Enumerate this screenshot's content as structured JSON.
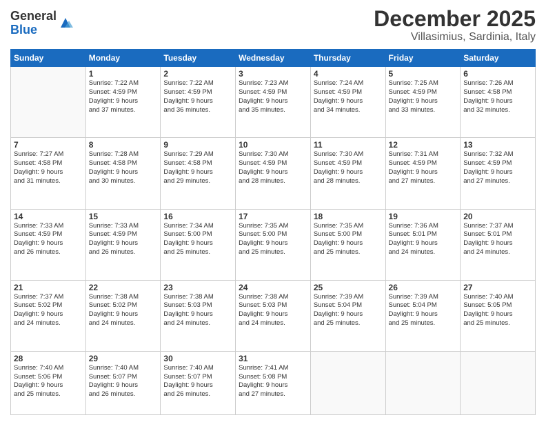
{
  "logo": {
    "general": "General",
    "blue": "Blue"
  },
  "header": {
    "month": "December 2025",
    "location": "Villasimius, Sardinia, Italy"
  },
  "weekdays": [
    "Sunday",
    "Monday",
    "Tuesday",
    "Wednesday",
    "Thursday",
    "Friday",
    "Saturday"
  ],
  "weeks": [
    [
      {
        "day": "",
        "info": ""
      },
      {
        "day": "1",
        "info": "Sunrise: 7:22 AM\nSunset: 4:59 PM\nDaylight: 9 hours\nand 37 minutes."
      },
      {
        "day": "2",
        "info": "Sunrise: 7:22 AM\nSunset: 4:59 PM\nDaylight: 9 hours\nand 36 minutes."
      },
      {
        "day": "3",
        "info": "Sunrise: 7:23 AM\nSunset: 4:59 PM\nDaylight: 9 hours\nand 35 minutes."
      },
      {
        "day": "4",
        "info": "Sunrise: 7:24 AM\nSunset: 4:59 PM\nDaylight: 9 hours\nand 34 minutes."
      },
      {
        "day": "5",
        "info": "Sunrise: 7:25 AM\nSunset: 4:59 PM\nDaylight: 9 hours\nand 33 minutes."
      },
      {
        "day": "6",
        "info": "Sunrise: 7:26 AM\nSunset: 4:58 PM\nDaylight: 9 hours\nand 32 minutes."
      }
    ],
    [
      {
        "day": "7",
        "info": "Sunrise: 7:27 AM\nSunset: 4:58 PM\nDaylight: 9 hours\nand 31 minutes."
      },
      {
        "day": "8",
        "info": "Sunrise: 7:28 AM\nSunset: 4:58 PM\nDaylight: 9 hours\nand 30 minutes."
      },
      {
        "day": "9",
        "info": "Sunrise: 7:29 AM\nSunset: 4:58 PM\nDaylight: 9 hours\nand 29 minutes."
      },
      {
        "day": "10",
        "info": "Sunrise: 7:30 AM\nSunset: 4:59 PM\nDaylight: 9 hours\nand 28 minutes."
      },
      {
        "day": "11",
        "info": "Sunrise: 7:30 AM\nSunset: 4:59 PM\nDaylight: 9 hours\nand 28 minutes."
      },
      {
        "day": "12",
        "info": "Sunrise: 7:31 AM\nSunset: 4:59 PM\nDaylight: 9 hours\nand 27 minutes."
      },
      {
        "day": "13",
        "info": "Sunrise: 7:32 AM\nSunset: 4:59 PM\nDaylight: 9 hours\nand 27 minutes."
      }
    ],
    [
      {
        "day": "14",
        "info": "Sunrise: 7:33 AM\nSunset: 4:59 PM\nDaylight: 9 hours\nand 26 minutes."
      },
      {
        "day": "15",
        "info": "Sunrise: 7:33 AM\nSunset: 4:59 PM\nDaylight: 9 hours\nand 26 minutes."
      },
      {
        "day": "16",
        "info": "Sunrise: 7:34 AM\nSunset: 5:00 PM\nDaylight: 9 hours\nand 25 minutes."
      },
      {
        "day": "17",
        "info": "Sunrise: 7:35 AM\nSunset: 5:00 PM\nDaylight: 9 hours\nand 25 minutes."
      },
      {
        "day": "18",
        "info": "Sunrise: 7:35 AM\nSunset: 5:00 PM\nDaylight: 9 hours\nand 25 minutes."
      },
      {
        "day": "19",
        "info": "Sunrise: 7:36 AM\nSunset: 5:01 PM\nDaylight: 9 hours\nand 24 minutes."
      },
      {
        "day": "20",
        "info": "Sunrise: 7:37 AM\nSunset: 5:01 PM\nDaylight: 9 hours\nand 24 minutes."
      }
    ],
    [
      {
        "day": "21",
        "info": "Sunrise: 7:37 AM\nSunset: 5:02 PM\nDaylight: 9 hours\nand 24 minutes."
      },
      {
        "day": "22",
        "info": "Sunrise: 7:38 AM\nSunset: 5:02 PM\nDaylight: 9 hours\nand 24 minutes."
      },
      {
        "day": "23",
        "info": "Sunrise: 7:38 AM\nSunset: 5:03 PM\nDaylight: 9 hours\nand 24 minutes."
      },
      {
        "day": "24",
        "info": "Sunrise: 7:38 AM\nSunset: 5:03 PM\nDaylight: 9 hours\nand 24 minutes."
      },
      {
        "day": "25",
        "info": "Sunrise: 7:39 AM\nSunset: 5:04 PM\nDaylight: 9 hours\nand 25 minutes."
      },
      {
        "day": "26",
        "info": "Sunrise: 7:39 AM\nSunset: 5:04 PM\nDaylight: 9 hours\nand 25 minutes."
      },
      {
        "day": "27",
        "info": "Sunrise: 7:40 AM\nSunset: 5:05 PM\nDaylight: 9 hours\nand 25 minutes."
      }
    ],
    [
      {
        "day": "28",
        "info": "Sunrise: 7:40 AM\nSunset: 5:06 PM\nDaylight: 9 hours\nand 25 minutes."
      },
      {
        "day": "29",
        "info": "Sunrise: 7:40 AM\nSunset: 5:07 PM\nDaylight: 9 hours\nand 26 minutes."
      },
      {
        "day": "30",
        "info": "Sunrise: 7:40 AM\nSunset: 5:07 PM\nDaylight: 9 hours\nand 26 minutes."
      },
      {
        "day": "31",
        "info": "Sunrise: 7:41 AM\nSunset: 5:08 PM\nDaylight: 9 hours\nand 27 minutes."
      },
      {
        "day": "",
        "info": ""
      },
      {
        "day": "",
        "info": ""
      },
      {
        "day": "",
        "info": ""
      }
    ]
  ]
}
